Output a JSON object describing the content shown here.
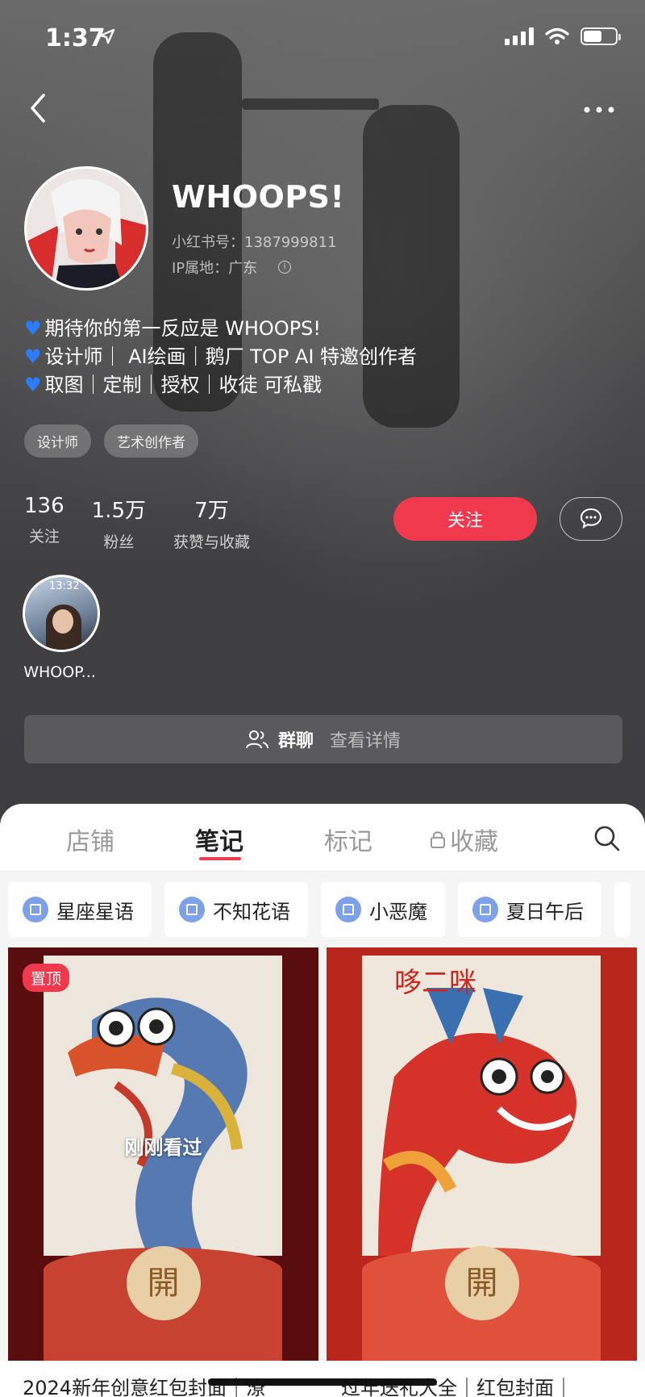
{
  "status_bar": {
    "time": "1:37"
  },
  "profile": {
    "name": "WHOOPS!",
    "id_line": "小红书号：1387999811",
    "ip_line": "IP属地：广东",
    "bio": [
      "期待你的第一反应是 WHOOPS!",
      "设计师｜ AI绘画｜鹅厂 TOP AI 特邀创作者",
      "取图｜定制｜授权｜收徒 可私戳"
    ],
    "tags": [
      "设计师",
      "艺术创作者"
    ],
    "stats": [
      {
        "value": "136",
        "label": "关注"
      },
      {
        "value": "1.5万",
        "label": "粉丝"
      },
      {
        "value": "7万",
        "label": "获赞与收藏"
      }
    ],
    "follow_label": "关注",
    "highlight": {
      "label": "WHOOP...",
      "time_text": "13:32"
    },
    "group_chat": {
      "title": "群聊",
      "subtitle": "查看详情"
    }
  },
  "tabs": [
    {
      "label": "店铺"
    },
    {
      "label": "笔记"
    },
    {
      "label": "标记"
    },
    {
      "label": "收藏"
    }
  ],
  "active_tab": "笔记",
  "chips": [
    "星座星语",
    "不知花语",
    "小恶魔",
    "夏日午后"
  ],
  "notes": [
    {
      "badge": "置顶",
      "overlay": "刚刚看过",
      "seal": "開",
      "title": "2024新年创意红包封面｜潦"
    },
    {
      "art_text": "哆二咪",
      "seal": "開",
      "title": "过年送礼大全｜红包封面｜"
    }
  ],
  "colors": {
    "accent": "#f1394e",
    "chip_icon": "#7da1e6",
    "heart": "#2b7cff"
  }
}
